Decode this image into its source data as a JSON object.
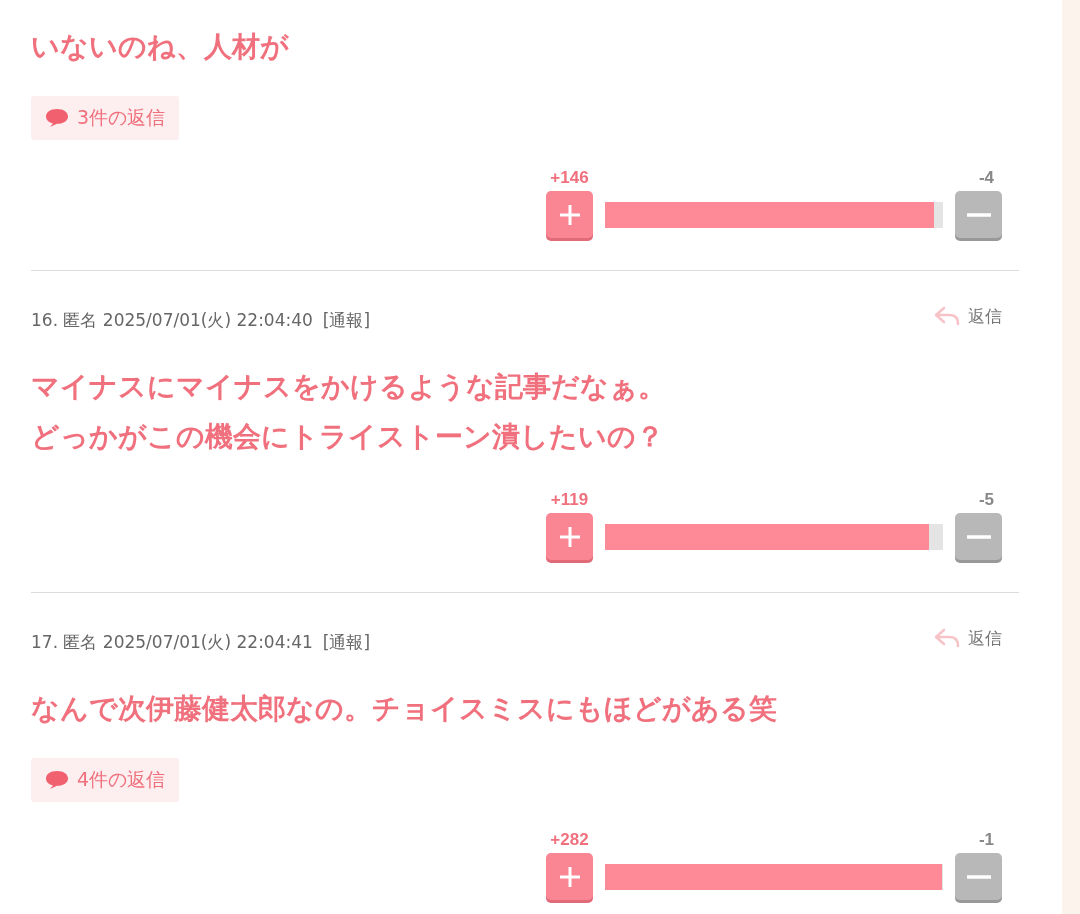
{
  "comments": [
    {
      "lines": [
        "いないのね、人材が"
      ],
      "replies": "3件の返信",
      "plus": "+146",
      "minus": "-4",
      "level": 0.973
    },
    {
      "header": {
        "meta": "16. 匿名 2025/07/01(火) 22:04:40",
        "report": "[通報]",
        "reply": "返信"
      },
      "lines": [
        "マイナスにマイナスをかけるような記事だなぁ。",
        "どっかがこの機会にトライストーン潰したいの？"
      ],
      "plus": "+119",
      "minus": "-5",
      "level": 0.96
    },
    {
      "header": {
        "meta": "17. 匿名 2025/07/01(火) 22:04:41",
        "report": "[通報]",
        "reply": "返信"
      },
      "lines": [
        "なんで次伊藤健太郎なの。チョイスミスにもほどがある笑"
      ],
      "replies": "4件の返信",
      "plus": "+282",
      "minus": "-1",
      "level": 0.996
    }
  ]
}
